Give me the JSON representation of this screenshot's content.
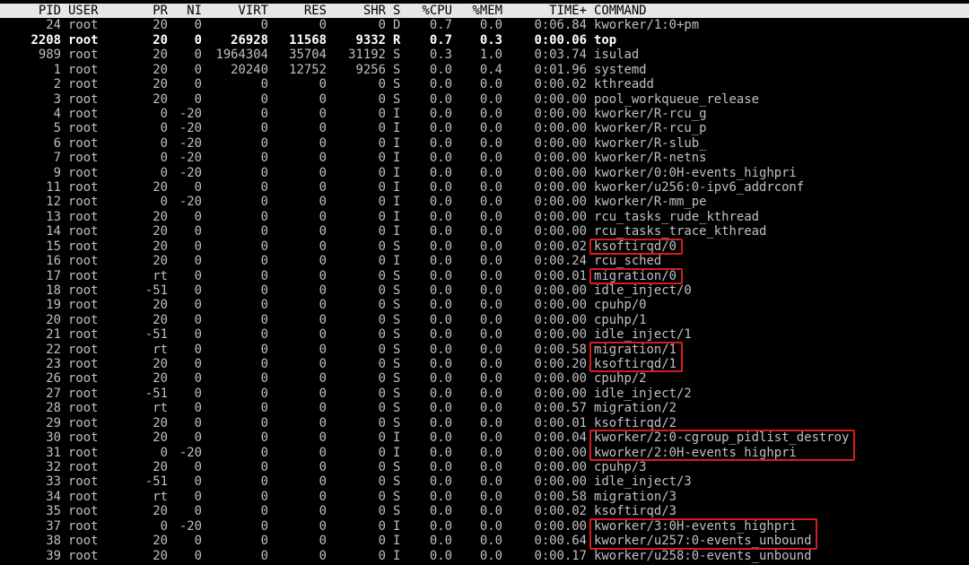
{
  "header": [
    "PID",
    "USER",
    "PR",
    "NI",
    "VIRT",
    "RES",
    "SHR",
    "S",
    "%CPU",
    "%MEM",
    "TIME+",
    "COMMAND"
  ],
  "rows": [
    [
      "24",
      "root",
      "20",
      "0",
      "0",
      "0",
      "0",
      "D",
      "0.7",
      "0.0",
      "0:06.84",
      "kworker/1:0+pm"
    ],
    [
      "2208",
      "root",
      "20",
      "0",
      "26928",
      "11568",
      "9332",
      "R",
      "0.7",
      "0.3",
      "0:00.06",
      "top"
    ],
    [
      "989",
      "root",
      "20",
      "0",
      "1964304",
      "35704",
      "31192",
      "S",
      "0.3",
      "1.0",
      "0:03.74",
      "isulad"
    ],
    [
      "1",
      "root",
      "20",
      "0",
      "20240",
      "12752",
      "9256",
      "S",
      "0.0",
      "0.4",
      "0:01.96",
      "systemd"
    ],
    [
      "2",
      "root",
      "20",
      "0",
      "0",
      "0",
      "0",
      "S",
      "0.0",
      "0.0",
      "0:00.02",
      "kthreadd"
    ],
    [
      "3",
      "root",
      "20",
      "0",
      "0",
      "0",
      "0",
      "S",
      "0.0",
      "0.0",
      "0:00.00",
      "pool_workqueue_release"
    ],
    [
      "4",
      "root",
      "0",
      "-20",
      "0",
      "0",
      "0",
      "I",
      "0.0",
      "0.0",
      "0:00.00",
      "kworker/R-rcu_g"
    ],
    [
      "5",
      "root",
      "0",
      "-20",
      "0",
      "0",
      "0",
      "I",
      "0.0",
      "0.0",
      "0:00.00",
      "kworker/R-rcu_p"
    ],
    [
      "6",
      "root",
      "0",
      "-20",
      "0",
      "0",
      "0",
      "I",
      "0.0",
      "0.0",
      "0:00.00",
      "kworker/R-slub_"
    ],
    [
      "7",
      "root",
      "0",
      "-20",
      "0",
      "0",
      "0",
      "I",
      "0.0",
      "0.0",
      "0:00.00",
      "kworker/R-netns"
    ],
    [
      "9",
      "root",
      "0",
      "-20",
      "0",
      "0",
      "0",
      "I",
      "0.0",
      "0.0",
      "0:00.00",
      "kworker/0:0H-events_highpri"
    ],
    [
      "11",
      "root",
      "20",
      "0",
      "0",
      "0",
      "0",
      "I",
      "0.0",
      "0.0",
      "0:00.00",
      "kworker/u256:0-ipv6_addrconf"
    ],
    [
      "12",
      "root",
      "0",
      "-20",
      "0",
      "0",
      "0",
      "I",
      "0.0",
      "0.0",
      "0:00.00",
      "kworker/R-mm_pe"
    ],
    [
      "13",
      "root",
      "20",
      "0",
      "0",
      "0",
      "0",
      "I",
      "0.0",
      "0.0",
      "0:00.00",
      "rcu_tasks_rude_kthread"
    ],
    [
      "14",
      "root",
      "20",
      "0",
      "0",
      "0",
      "0",
      "I",
      "0.0",
      "0.0",
      "0:00.00",
      "rcu_tasks_trace_kthread"
    ],
    [
      "15",
      "root",
      "20",
      "0",
      "0",
      "0",
      "0",
      "S",
      "0.0",
      "0.0",
      "0:00.02",
      "ksoftirqd/0"
    ],
    [
      "16",
      "root",
      "20",
      "0",
      "0",
      "0",
      "0",
      "I",
      "0.0",
      "0.0",
      "0:00.24",
      "rcu_sched"
    ],
    [
      "17",
      "root",
      "rt",
      "0",
      "0",
      "0",
      "0",
      "S",
      "0.0",
      "0.0",
      "0:00.01",
      "migration/0"
    ],
    [
      "18",
      "root",
      "-51",
      "0",
      "0",
      "0",
      "0",
      "S",
      "0.0",
      "0.0",
      "0:00.00",
      "idle_inject/0"
    ],
    [
      "19",
      "root",
      "20",
      "0",
      "0",
      "0",
      "0",
      "S",
      "0.0",
      "0.0",
      "0:00.00",
      "cpuhp/0"
    ],
    [
      "20",
      "root",
      "20",
      "0",
      "0",
      "0",
      "0",
      "S",
      "0.0",
      "0.0",
      "0:00.00",
      "cpuhp/1"
    ],
    [
      "21",
      "root",
      "-51",
      "0",
      "0",
      "0",
      "0",
      "S",
      "0.0",
      "0.0",
      "0:00.00",
      "idle_inject/1"
    ],
    [
      "22",
      "root",
      "rt",
      "0",
      "0",
      "0",
      "0",
      "S",
      "0.0",
      "0.0",
      "0:00.58",
      "migration/1"
    ],
    [
      "23",
      "root",
      "20",
      "0",
      "0",
      "0",
      "0",
      "S",
      "0.0",
      "0.0",
      "0:00.20",
      "ksoftirqd/1"
    ],
    [
      "26",
      "root",
      "20",
      "0",
      "0",
      "0",
      "0",
      "S",
      "0.0",
      "0.0",
      "0:00.00",
      "cpuhp/2"
    ],
    [
      "27",
      "root",
      "-51",
      "0",
      "0",
      "0",
      "0",
      "S",
      "0.0",
      "0.0",
      "0:00.00",
      "idle_inject/2"
    ],
    [
      "28",
      "root",
      "rt",
      "0",
      "0",
      "0",
      "0",
      "S",
      "0.0",
      "0.0",
      "0:00.57",
      "migration/2"
    ],
    [
      "29",
      "root",
      "20",
      "0",
      "0",
      "0",
      "0",
      "S",
      "0.0",
      "0.0",
      "0:00.01",
      "ksoftirqd/2"
    ],
    [
      "30",
      "root",
      "20",
      "0",
      "0",
      "0",
      "0",
      "I",
      "0.0",
      "0.0",
      "0:00.04",
      "kworker/2:0-cgroup_pidlist_destroy"
    ],
    [
      "31",
      "root",
      "0",
      "-20",
      "0",
      "0",
      "0",
      "I",
      "0.0",
      "0.0",
      "0:00.00",
      "kworker/2:0H-events_highpri"
    ],
    [
      "32",
      "root",
      "20",
      "0",
      "0",
      "0",
      "0",
      "S",
      "0.0",
      "0.0",
      "0:00.00",
      "cpuhp/3"
    ],
    [
      "33",
      "root",
      "-51",
      "0",
      "0",
      "0",
      "0",
      "S",
      "0.0",
      "0.0",
      "0:00.00",
      "idle_inject/3"
    ],
    [
      "34",
      "root",
      "rt",
      "0",
      "0",
      "0",
      "0",
      "S",
      "0.0",
      "0.0",
      "0:00.58",
      "migration/3"
    ],
    [
      "35",
      "root",
      "20",
      "0",
      "0",
      "0",
      "0",
      "S",
      "0.0",
      "0.0",
      "0:00.02",
      "ksoftirqd/3"
    ],
    [
      "37",
      "root",
      "0",
      "-20",
      "0",
      "0",
      "0",
      "I",
      "0.0",
      "0.0",
      "0:00.00",
      "kworker/3:0H-events_highpri"
    ],
    [
      "38",
      "root",
      "20",
      "0",
      "0",
      "0",
      "0",
      "I",
      "0.0",
      "0.0",
      "0:00.64",
      "kworker/u257:0-events_unbound"
    ],
    [
      "39",
      "root",
      "20",
      "0",
      "0",
      "0",
      "0",
      "I",
      "0.0",
      "0.0",
      "0:00.17",
      "kworker/u258:0-events_unbound"
    ]
  ],
  "bold_rows": [
    1
  ],
  "highlight_groups": [
    [
      15
    ],
    [
      17
    ],
    [
      22,
      23
    ],
    [
      28,
      29
    ],
    [
      34,
      35
    ]
  ],
  "colors": {
    "background": "#000000",
    "text": "#c0c0c0",
    "bold_text": "#ffffff",
    "header_bg": "#e6e6e6",
    "header_text": "#000000",
    "highlight_border": "#d71c1c"
  }
}
